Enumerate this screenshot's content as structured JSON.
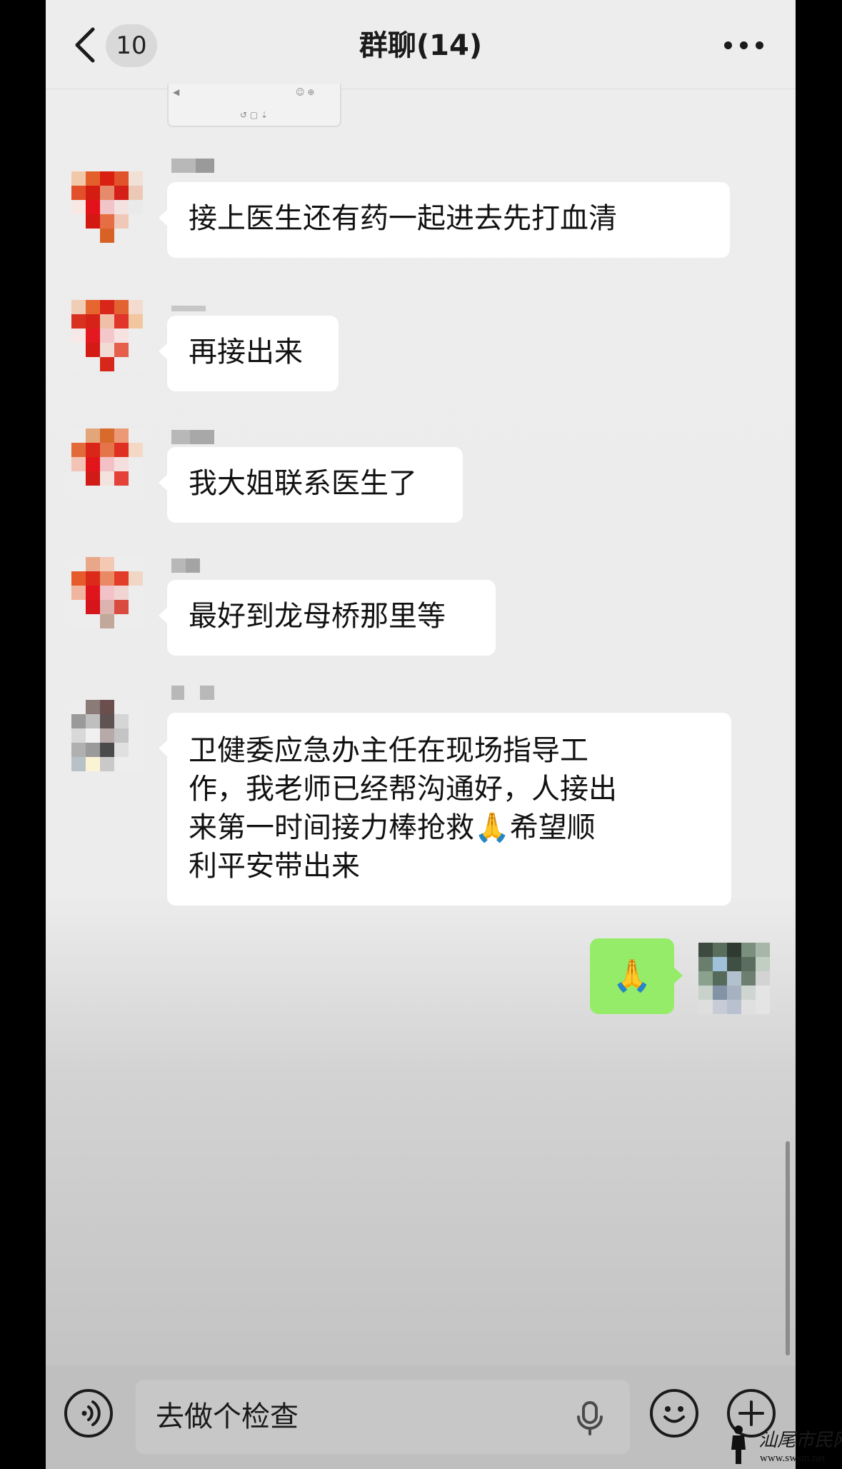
{
  "header": {
    "unread_count": "10",
    "title": "群聊(14)"
  },
  "messages": [
    {
      "text": "接上医生还有药一起进去先打血清"
    },
    {
      "text": "再接出来"
    },
    {
      "text": "我大姐联系医生了"
    },
    {
      "text": "最好到龙母桥那里等"
    },
    {
      "line1": "卫健委应急办主任在现场指导工",
      "line2": "作，我老师已经帮沟通好，人接出",
      "line3": "来第一时间接力棒抢救🙏希望顺",
      "line4": "利平安带出来"
    }
  ],
  "my_message": {
    "text": "🙏"
  },
  "input": {
    "text": "去做个检查"
  },
  "watermark": {
    "text": "汕尾市民网",
    "url": "www.swsm.net"
  }
}
